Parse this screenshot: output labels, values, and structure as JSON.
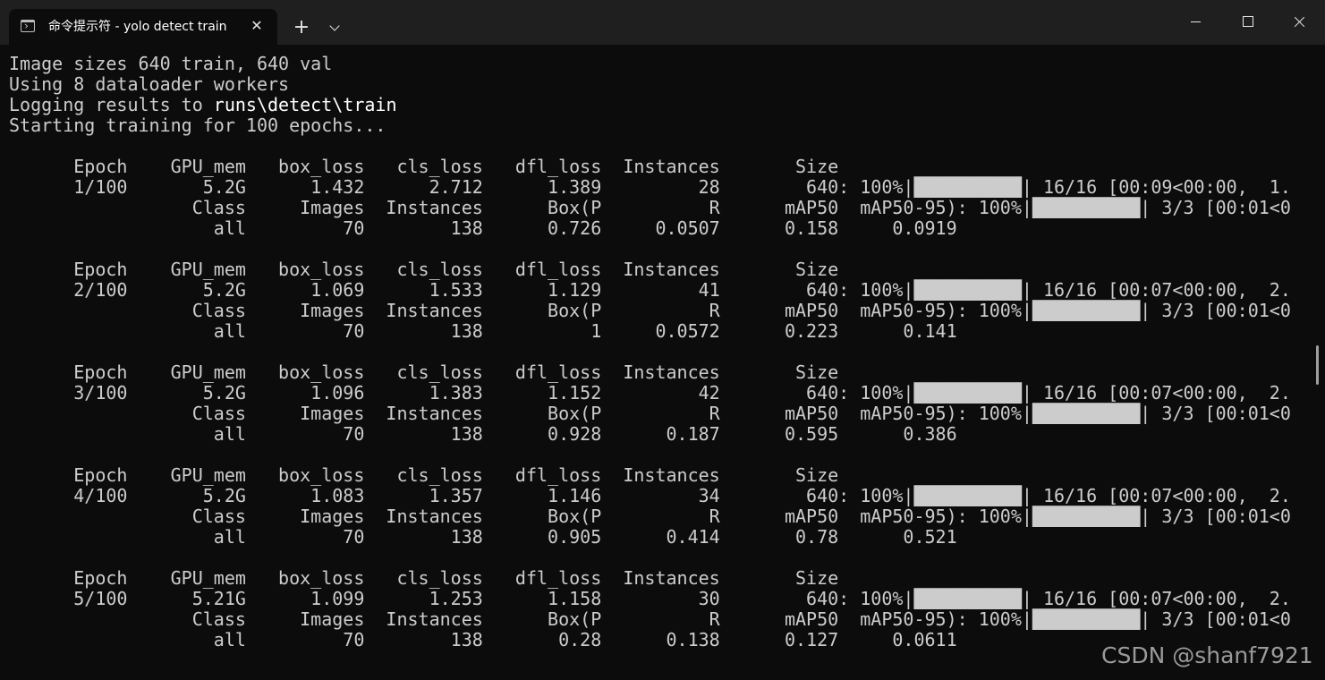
{
  "window": {
    "tab_title": "命令提示符 - yolo  detect train",
    "tab_close_label": "✕",
    "new_tab_label": "+",
    "dropdown_label": "",
    "minimize_label": "",
    "maximize_label": "",
    "close_label": ""
  },
  "colors": {
    "background": "#0c0c0c",
    "titlebar": "#1f1f1f",
    "text": "#cccccc",
    "highlight": "#ffffff"
  },
  "icons": {
    "tab": "terminal-icon",
    "close_tab": "close-icon",
    "new_tab": "plus-icon",
    "dropdown": "chevron-down-icon",
    "minimize": "minimize-icon",
    "maximize": "maximize-icon",
    "window_close": "close-icon"
  },
  "console": {
    "line_01": "Image sizes 640 train, 640 val",
    "line_02": "Using 8 dataloader workers",
    "line_03_prefix": "Logging results to ",
    "line_03_path": "runs\\detect\\train",
    "line_04": "Starting training for 100 epochs...",
    "line_05": "",
    "line_06": "      Epoch    GPU_mem   box_loss   cls_loss   dfl_loss  Instances       Size",
    "line_07": "      1/100       5.2G      1.432      2.712      1.389         28        640: 100%|██████████| 16/16 [00:09<00:00,  1.",
    "line_08": "                 Class     Images  Instances      Box(P          R      mAP50  mAP50-95): 100%|██████████| 3/3 [00:01<0",
    "line_09": "                   all         70        138      0.726     0.0507      0.158     0.0919",
    "line_10": "",
    "line_11": "      Epoch    GPU_mem   box_loss   cls_loss   dfl_loss  Instances       Size",
    "line_12": "      2/100       5.2G      1.069      1.533      1.129         41        640: 100%|██████████| 16/16 [00:07<00:00,  2.",
    "line_13": "                 Class     Images  Instances      Box(P          R      mAP50  mAP50-95): 100%|██████████| 3/3 [00:01<0",
    "line_14": "                   all         70        138          1     0.0572      0.223      0.141",
    "line_15": "",
    "line_16": "      Epoch    GPU_mem   box_loss   cls_loss   dfl_loss  Instances       Size",
    "line_17": "      3/100       5.2G      1.096      1.383      1.152         42        640: 100%|██████████| 16/16 [00:07<00:00,  2.",
    "line_18": "                 Class     Images  Instances      Box(P          R      mAP50  mAP50-95): 100%|██████████| 3/3 [00:01<0",
    "line_19": "                   all         70        138      0.928      0.187      0.595      0.386",
    "line_20": "",
    "line_21": "      Epoch    GPU_mem   box_loss   cls_loss   dfl_loss  Instances       Size",
    "line_22": "      4/100       5.2G      1.083      1.357      1.146         34        640: 100%|██████████| 16/16 [00:07<00:00,  2.",
    "line_23": "                 Class     Images  Instances      Box(P          R      mAP50  mAP50-95): 100%|██████████| 3/3 [00:01<0",
    "line_24": "                   all         70        138      0.905      0.414       0.78      0.521",
    "line_25": "",
    "line_26": "      Epoch    GPU_mem   box_loss   cls_loss   dfl_loss  Instances       Size",
    "line_27": "      5/100      5.21G      1.099      1.253      1.158         30        640: 100%|██████████| 16/16 [00:07<00:00,  2.",
    "line_28": "                 Class     Images  Instances      Box(P          R      mAP50  mAP50-95): 100%|██████████| 3/3 [00:01<0",
    "line_29": "                   all         70        138       0.28      0.138      0.127     0.0611"
  },
  "watermark": "CSDN @shanf7921"
}
